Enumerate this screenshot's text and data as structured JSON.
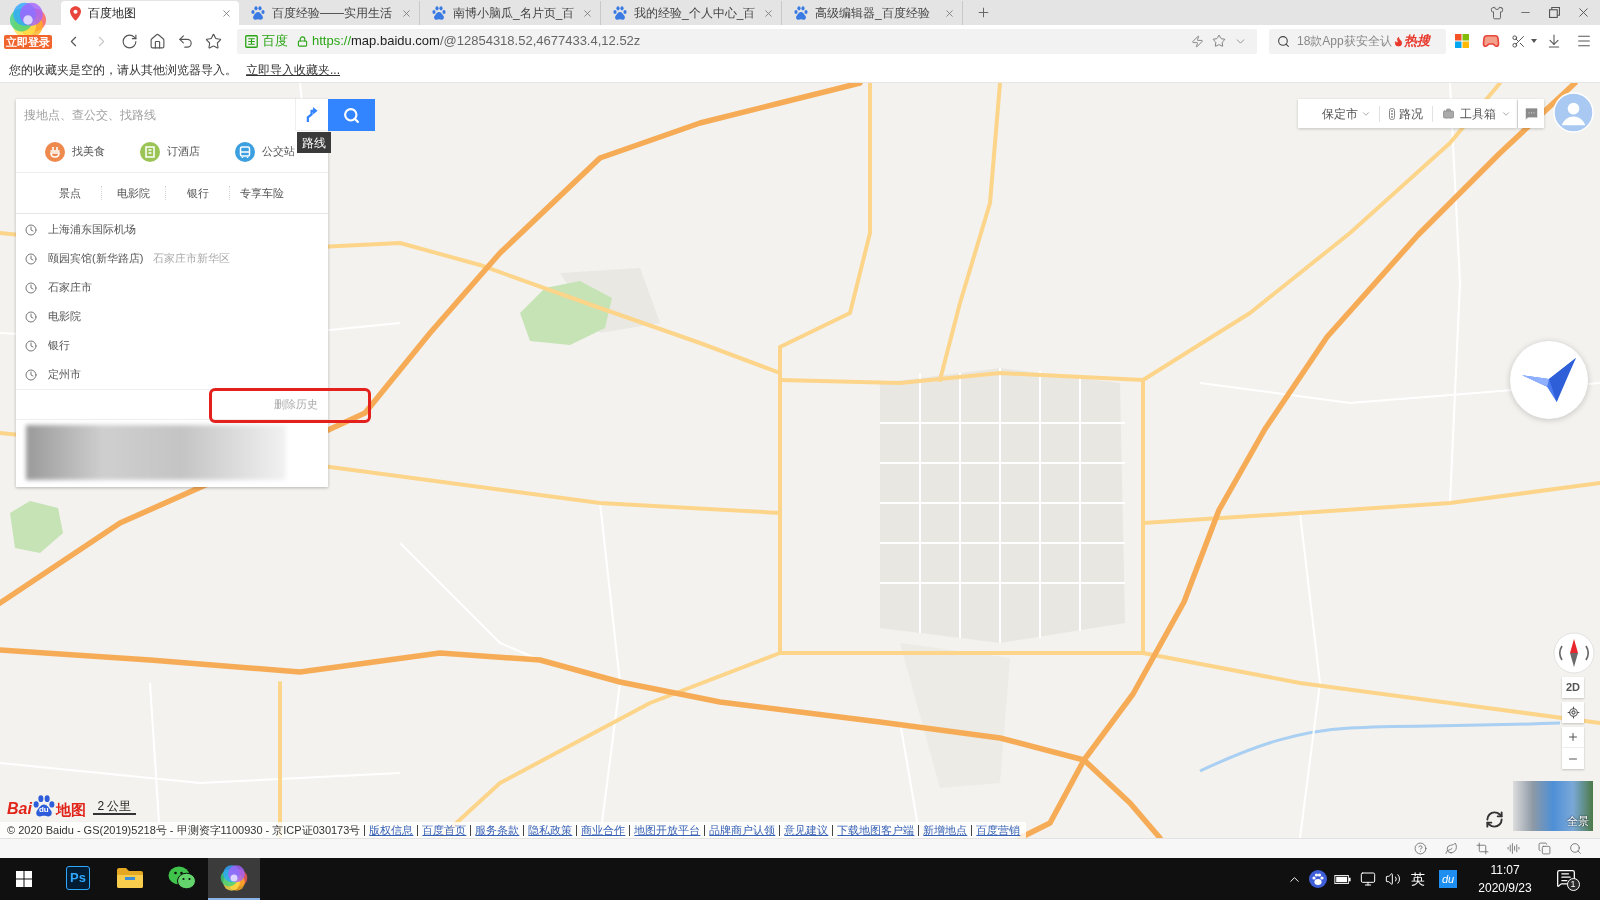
{
  "browser": {
    "login_badge": "立即登录",
    "tabs": [
      {
        "title": "百度地图",
        "kind": "map",
        "selected": true
      },
      {
        "title": "百度经验——实用生活",
        "kind": "site",
        "selected": false
      },
      {
        "title": "南博小脑瓜_名片页_百",
        "kind": "site",
        "selected": false
      },
      {
        "title": "我的经验_个人中心_百",
        "kind": "site",
        "selected": false
      },
      {
        "title": "高级编辑器_百度经验",
        "kind": "site",
        "selected": false
      }
    ],
    "nav_buttons": [
      {
        "kind": "back",
        "disabled": false
      },
      {
        "kind": "forward",
        "disabled": true
      },
      {
        "kind": "reload",
        "disabled": false
      },
      {
        "kind": "home",
        "disabled": false
      },
      {
        "kind": "restore",
        "disabled": false
      },
      {
        "kind": "favorite",
        "disabled": false
      }
    ],
    "address_bar": {
      "site_badge": "百度",
      "url_scheme": "https://",
      "url_host": "map.baidu.com",
      "url_path": "/@12854318.52,4677433.4,12.52z"
    },
    "search": {
      "placeholder": "18款App获安全认",
      "hot_label": "热搜"
    },
    "bookmarks_bar": {
      "message": "您的收藏夹是空的，请从其他浏览器导入。",
      "link": "立即导入收藏夹..."
    }
  },
  "map": {
    "search": {
      "placeholder": "搜地点、查公交、找路线",
      "route_tooltip": "路线"
    },
    "categories": [
      {
        "label": "找美食",
        "kind": "food",
        "color": "#ef8a4e"
      },
      {
        "label": "订酒店",
        "kind": "hotel",
        "color": "#9ac455"
      },
      {
        "label": "公交站",
        "kind": "bus",
        "color": "#3b9fe0"
      }
    ],
    "quick_links": [
      "景点",
      "电影院",
      "银行",
      "专享车险"
    ],
    "history": [
      {
        "name": "上海浦东国际机场"
      },
      {
        "name": "颐园宾馆(新华路店)",
        "area": "石家庄市新华区"
      },
      {
        "name": "石家庄市"
      },
      {
        "name": "电影院"
      },
      {
        "name": "银行"
      },
      {
        "name": "定州市"
      }
    ],
    "delete_history": "删除历史",
    "toolbar": {
      "city": "保定市",
      "traffic": "路况",
      "toolbox": "工具箱"
    },
    "view_mode": "2D",
    "panorama": "全景",
    "logo": {
      "prefix": "Bai",
      "paw": "du",
      "suffix": "地图"
    },
    "scale": "2 公里",
    "copyright": "© 2020 Baidu - GS(2019)5218号 - 甲测资字1100930 - 京ICP证030173号",
    "footer_links": [
      "版权信息",
      "百度首页",
      "服务条款",
      "隐私政策",
      "商业合作",
      "地图开放平台",
      "品牌商户认领",
      "意见建议",
      "下载地图客户端",
      "新增地点",
      "百度营销"
    ]
  },
  "taskbar": {
    "apps": [
      {
        "kind": "photoshop",
        "label": "Ps",
        "selected": false
      },
      {
        "kind": "explorer",
        "selected": false
      },
      {
        "kind": "wechat",
        "selected": false
      },
      {
        "kind": "browser",
        "selected": true
      }
    ],
    "ime": "英",
    "tray_app_label": "du",
    "time": "11:07",
    "date": "2020/9/23",
    "notifications": "1"
  }
}
